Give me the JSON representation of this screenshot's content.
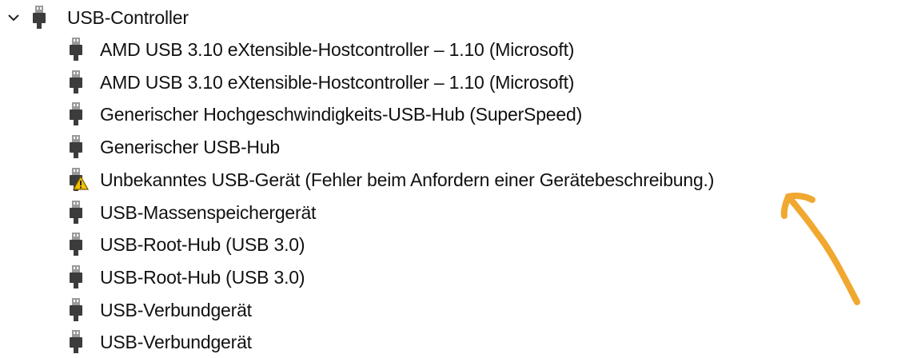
{
  "category": {
    "label": "USB-Controller",
    "expanded": true,
    "expander_icon": "chevron-down-icon",
    "icon": "usb-plug-icon"
  },
  "devices": [
    {
      "label": "AMD USB 3.10 eXtensible-Hostcontroller – 1.10 (Microsoft)",
      "icon": "usb-plug-icon",
      "warning": false
    },
    {
      "label": "AMD USB 3.10 eXtensible-Hostcontroller – 1.10 (Microsoft)",
      "icon": "usb-plug-icon",
      "warning": false
    },
    {
      "label": "Generischer Hochgeschwindigkeits-USB-Hub (SuperSpeed)",
      "icon": "usb-plug-icon",
      "warning": false
    },
    {
      "label": "Generischer USB-Hub",
      "icon": "usb-plug-icon",
      "warning": false
    },
    {
      "label": "Unbekanntes USB-Gerät (Fehler beim Anfordern einer Gerätebeschreibung.)",
      "icon": "usb-plug-warning-icon",
      "warning": true
    },
    {
      "label": "USB-Massenspeichergerät",
      "icon": "usb-plug-icon",
      "warning": false
    },
    {
      "label": "USB-Root-Hub (USB 3.0)",
      "icon": "usb-plug-icon",
      "warning": false
    },
    {
      "label": "USB-Root-Hub (USB 3.0)",
      "icon": "usb-plug-icon",
      "warning": false
    },
    {
      "label": "USB-Verbundgerät",
      "icon": "usb-plug-icon",
      "warning": false
    },
    {
      "label": "USB-Verbundgerät",
      "icon": "usb-plug-icon",
      "warning": false
    }
  ],
  "colors": {
    "text": "#111111",
    "icon_dark": "#3c3c3c",
    "icon_light": "#9a9a9a",
    "warning_fill": "#f2c200",
    "warning_stroke": "#7a5a00",
    "annotation": "#f0a830"
  }
}
